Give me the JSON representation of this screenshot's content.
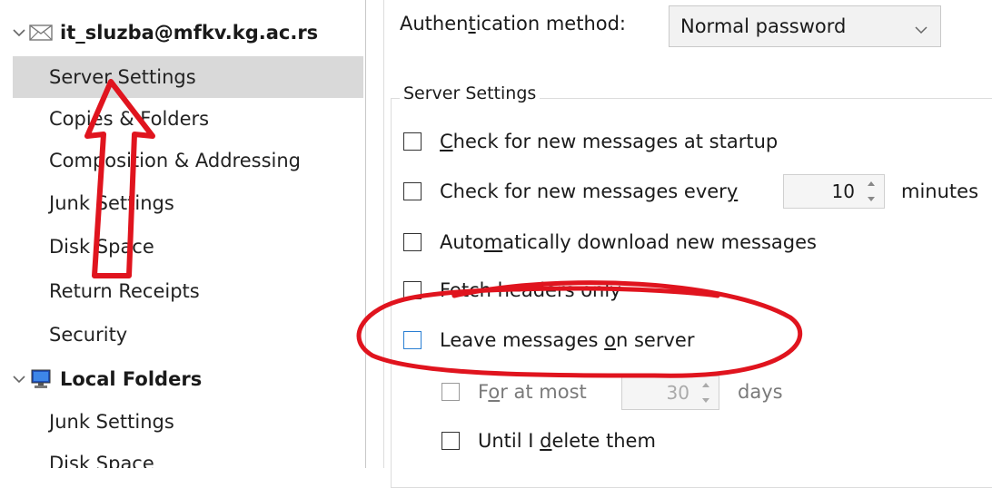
{
  "tree": {
    "account": {
      "name": "it_sluzba@mfkv.kg.ac.rs",
      "icon": "envelope-icon"
    },
    "account_items": [
      {
        "label": "Server Settings",
        "selected": true
      },
      {
        "label": "Copies & Folders"
      },
      {
        "label": "Composition & Addressing"
      },
      {
        "label": "Junk Settings"
      },
      {
        "label": "Disk Space"
      },
      {
        "label": "Return Receipts"
      },
      {
        "label": "Security"
      }
    ],
    "local": {
      "name": "Local Folders",
      "icon": "computer-icon"
    },
    "local_items": [
      {
        "label": "Junk Settings"
      },
      {
        "label": "Disk Space"
      }
    ]
  },
  "panel": {
    "auth_label_pre": "Authen",
    "auth_label_key": "t",
    "auth_label_post": "ication method:",
    "auth_value": "Normal password",
    "group_title": "Server Settings",
    "check_startup": {
      "key": "C",
      "rest": "heck for new messages at startup"
    },
    "check_every": {
      "pre": "Check for new messages ever",
      "key": "y",
      "value": "10",
      "unit": "minutes"
    },
    "auto_download": {
      "pre": "Auto",
      "key": "m",
      "post": "atically download new messages"
    },
    "fetch_headers": {
      "text": "Fetch headers only"
    },
    "leave_on_server": {
      "pre": "Leave messages ",
      "key": "o",
      "post": "n server"
    },
    "for_at_most": {
      "pre": "F",
      "key": "o",
      "post": "r at most",
      "value": "30",
      "unit": "days"
    },
    "until_delete": {
      "pre": "Until I ",
      "key": "d",
      "post": "elete them"
    }
  },
  "colors": {
    "annotation_red": "#e0141e",
    "selection": "#d9d9d9",
    "focus_blue": "#2a7fd3"
  }
}
